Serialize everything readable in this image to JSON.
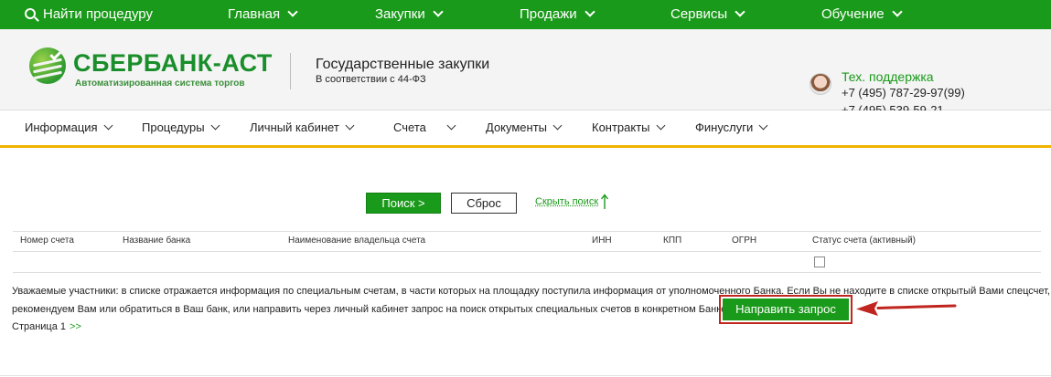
{
  "topbar": {
    "items": [
      {
        "label": "Найти процедуру"
      },
      {
        "label": "Главная"
      },
      {
        "label": "Закупки"
      },
      {
        "label": "Продажи"
      },
      {
        "label": "Сервисы"
      },
      {
        "label": "Обучение"
      }
    ]
  },
  "header": {
    "logo_text": "СБЕРБАНК-АСТ",
    "logo_subtitle": "Автоматизированная система торгов",
    "site_title": "Государственные закупки",
    "site_subtitle": "В соответствии с 44-ФЗ",
    "support_label": "Тех. поддержка",
    "phone_1": "+7 (495) 787-29-97(99)",
    "phone_2": "+7 (495) 539-59-21"
  },
  "subnav": {
    "items": [
      {
        "label": "Информация"
      },
      {
        "label": "Процедуры"
      },
      {
        "label": "Личный кабинет"
      },
      {
        "label": "Счета"
      },
      {
        "label": "Документы"
      },
      {
        "label": "Контракты"
      },
      {
        "label": "Финуслуги"
      }
    ]
  },
  "search": {
    "search_label": "Поиск >",
    "reset_label": "Сброс",
    "hide_label": "Скрыть поиск"
  },
  "table": {
    "columns": [
      "Номер счета",
      "Название банка",
      "Наименование владельца счета",
      "ИНН",
      "КПП",
      "ОГРН",
      "Статус счета (активный)"
    ]
  },
  "notice": {
    "line1": "Уважаемые участники: в списке отражается информация по специальным счетам, в части которых на площадку поступила информация от уполномоченного Банка. Если Вы не находите в списке открытый Вами спецсчет,",
    "line2": "рекомендуем Вам или обратиться в Ваш банк, или направить через личный кабинет запрос на поиск открытых специальных счетов в конкретном Банке",
    "request_label": "Направить запрос"
  },
  "pager": {
    "page_label": "Страница 1",
    "next_label": ">>"
  },
  "colors": {
    "brand_green": "#1a9a1a",
    "accent_yellow": "#f0b400",
    "highlight_red": "#c0261f"
  },
  "icons": [
    "search-icon",
    "chevron-down-icon",
    "sberbank-logo-icon",
    "avatar-icon",
    "arrow-up-icon",
    "red-arrow-icon"
  ]
}
